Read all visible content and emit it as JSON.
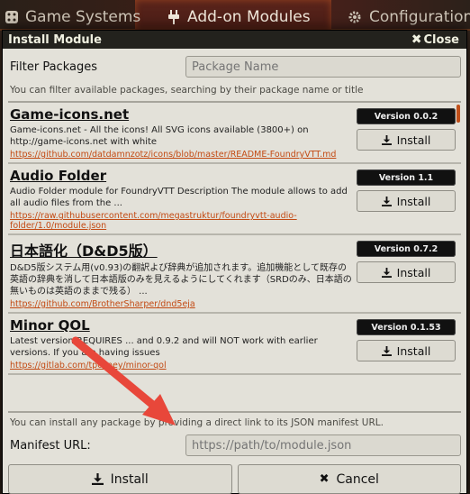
{
  "background_tabs": [
    {
      "label": "Game Systems",
      "icon": "dice-icon"
    },
    {
      "label": "Add-on Modules",
      "icon": "plug-icon",
      "active": true
    },
    {
      "label": "Configuration",
      "icon": "gears-icon"
    }
  ],
  "window": {
    "title": "Install Module",
    "close_label": "Close"
  },
  "filter": {
    "label": "Filter Packages",
    "placeholder": "Package Name",
    "hint": "You can filter available packages, searching by their package name or title"
  },
  "packages": [
    {
      "title": "Game-icons.net",
      "description": "Game-icons.net - All the icons! All SVG icons available (3800+) on http://game-icons.net with white",
      "url": "https://github.com/datdamnzotz/icons/blob/master/README-FoundryVTT.md",
      "version": "Version 0.0.2",
      "install_label": "Install"
    },
    {
      "title": "Audio Folder",
      "description": "Audio Folder module for FoundryVTT Description The module allows to add all audio files from the ...",
      "url": "https://raw.githubusercontent.com/megastruktur/foundryvtt-audio-folder/1.0/module.json",
      "version": "Version 1.1",
      "install_label": "Install"
    },
    {
      "title": "日本語化（D&D5版）",
      "description": "D&D5版システム用(v0.93)の翻訳よび辞典が追加されます。追加機能として既存の英語の辞典を消して日本語版のみを見えるようにしてくれます（SRDのみ、日本語の無いものは英語のままで残る） ...",
      "url": "https://github.com/BrotherSharper/dnd5eja",
      "version": "Version 0.7.2",
      "install_label": "Install"
    },
    {
      "title": "Minor QOL",
      "description": "Latest version REQUIRES ... and 0.9.2 and will NOT work with earlier versions. If you are having issues",
      "url": "https://gitlab.com/tposney/minor-qol",
      "version": "Version 0.1.53",
      "install_label": "Install"
    }
  ],
  "footer": {
    "hint": "You can install any package by providing a direct link to its JSON manifest URL.",
    "manifest_label": "Manifest URL:",
    "manifest_placeholder": "https://path/to/module.json",
    "install_label": "Install",
    "cancel_label": "Cancel"
  },
  "colors": {
    "annotation_arrow": "#e8473a",
    "link": "#c34a13",
    "window_bg": "#e3e1d9"
  }
}
